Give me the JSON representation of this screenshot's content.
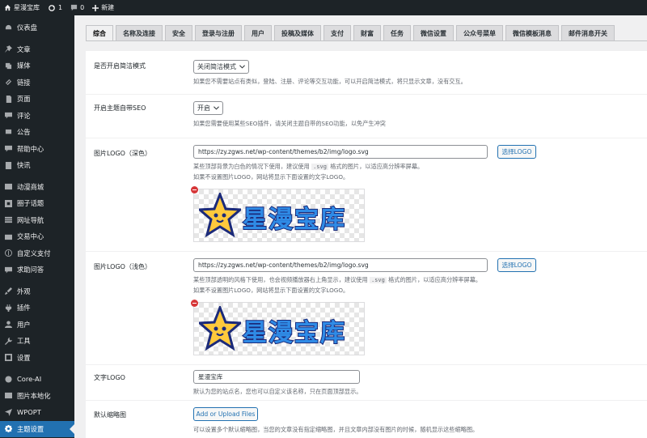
{
  "adminbar": {
    "site_name": "星漫宝库",
    "updates_count": "1",
    "comments_count": "0",
    "new_label": "新建"
  },
  "sidebar": {
    "items": [
      {
        "label": "仪表盘",
        "icon": "dashboard-icon"
      },
      {
        "label": "文章",
        "icon": "pin-icon"
      },
      {
        "label": "媒体",
        "icon": "media-icon"
      },
      {
        "label": "链接",
        "icon": "link-icon"
      },
      {
        "label": "页面",
        "icon": "page-icon"
      },
      {
        "label": "评论",
        "icon": "comment-icon"
      },
      {
        "label": "公告",
        "icon": "megaphone-icon"
      },
      {
        "label": "帮助中心",
        "icon": "help-icon"
      },
      {
        "label": "快讯",
        "icon": "flash-icon"
      },
      {
        "label": "动漫商城",
        "icon": "shop-icon"
      },
      {
        "label": "圈子话题",
        "icon": "circle-icon"
      },
      {
        "label": "网址导航",
        "icon": "nav-icon"
      },
      {
        "label": "交易中心",
        "icon": "trade-icon"
      },
      {
        "label": "自定义支付",
        "icon": "dollar-icon"
      },
      {
        "label": "求助问答",
        "icon": "qa-icon"
      },
      {
        "label": "外观",
        "icon": "brush-icon"
      },
      {
        "label": "插件",
        "icon": "plugin-icon"
      },
      {
        "label": "用户",
        "icon": "user-icon"
      },
      {
        "label": "工具",
        "icon": "wrench-icon"
      },
      {
        "label": "设置",
        "icon": "settings-icon"
      },
      {
        "label": "Core-AI",
        "icon": "core-ai-icon"
      },
      {
        "label": "图片本地化",
        "icon": "image-icon"
      },
      {
        "label": "WPOPT",
        "icon": "wpopt-icon"
      },
      {
        "label": "主题设置",
        "icon": "gear-icon"
      }
    ]
  },
  "tabs": [
    "综合",
    "名称及连接",
    "安全",
    "登录与注册",
    "用户",
    "投稿及媒体",
    "支付",
    "财富",
    "任务",
    "微信设置",
    "公众号菜单",
    "微信模板消息",
    "邮件消息开关"
  ],
  "settings": {
    "simple_mode": {
      "label": "是否开启简洁模式",
      "value": "关闭简洁模式",
      "desc": "如果您不需要站点有类似，登陆、注册、评论等交互功能，可以开启简洁模式，将只显示文章，没有交互。"
    },
    "seo": {
      "label": "开启主题自带SEO",
      "value": "开启",
      "desc": "如果您需要使用某些SEO插件，请关闭主题自带的SEO功能，以免产生冲突"
    },
    "logo_dark": {
      "label": "图片LOGO（深色）",
      "value": "https://zy.zgws.net/wp-content/themes/b2/img/logo.svg",
      "button": "选择LOGO",
      "desc1_pre": "某些顶部背景为白色的情况下使用，建议使用",
      "desc1_code": ".svg",
      "desc1_post": "格式的图片，以适应高分辨率屏幕。",
      "desc2": "如果不设置图片LOGO，网站将显示下面设置的文字LOGO。"
    },
    "logo_light": {
      "label": "图片LOGO（浅色）",
      "value": "https://zy.zgws.net/wp-content/themes/b2/img/logo.svg",
      "button": "选择LOGO",
      "desc1_pre": "某些顶部透明的风格下使用，也会视频播放器右上角显示，建议使用",
      "desc1_code": ".svg",
      "desc1_post": "格式的图片，以适应高分辨率屏幕。",
      "desc2": "如果不设置图片LOGO，网站将显示下面设置的文字LOGO。"
    },
    "logo_image_text": "星漫宝库",
    "text_logo": {
      "label": "文字LOGO",
      "value": "星漫宝库",
      "desc": "默认为您的站点名，您也可以自定义该名称，只在页面顶部显示。"
    },
    "thumbnail": {
      "label": "默认缩略图",
      "button": "Add or Upload Files",
      "desc": "可以设置多个默认缩略图，当您的文章没有指定缩略图，并且文章内部没有图片的时候，随机显示这些缩略图。"
    }
  },
  "colors": {
    "admin_dark": "#1d2327",
    "accent": "#2271b1"
  }
}
